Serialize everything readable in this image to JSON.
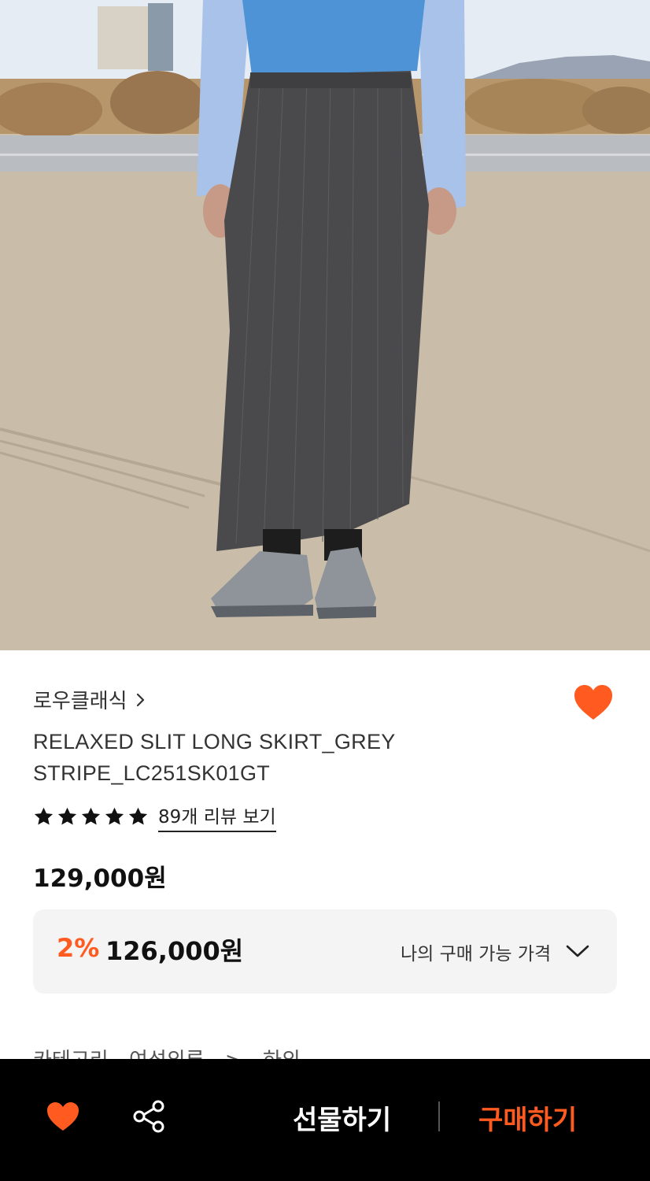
{
  "product": {
    "brand": "로우클래식",
    "title_line1": "RELAXED SLIT LONG SKIRT_GREY",
    "title_line2": "STRIPE_LC251SK01GT",
    "rating_stars": 5,
    "review_link": "89개 리뷰 보기",
    "price": "129,000원"
  },
  "deal": {
    "rate": "2%",
    "price": "126,000원",
    "label": "나의 구매 가능 가격"
  },
  "category_peek": [
    "카테고리",
    "여성의류",
    ">",
    "하의"
  ],
  "bottom_bar": {
    "gift_label": "선물하기",
    "buy_label": "구매하기"
  },
  "colors": {
    "accent": "#ff5a1f",
    "bar_bg": "#000000",
    "deal_bg": "#f4f4f4"
  },
  "icons": {
    "wishlist": "heart-icon",
    "share": "share-icon",
    "chevron": "chevron-right-icon",
    "dropdown": "chevron-down-icon",
    "rating": "star-icon"
  }
}
